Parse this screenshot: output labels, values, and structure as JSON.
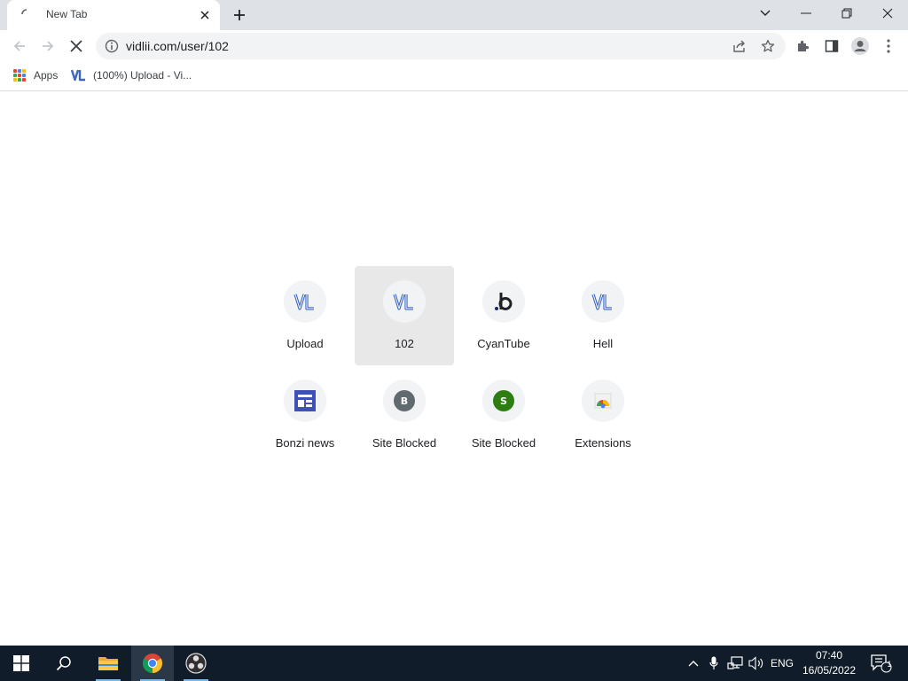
{
  "browser": {
    "tab": {
      "title": "New Tab"
    },
    "address_bar": {
      "url": "vidlii.com/user/102"
    },
    "bookmarks": [
      {
        "label": "Apps"
      },
      {
        "label": "(100%) Upload - Vi..."
      }
    ]
  },
  "shortcuts": [
    {
      "label": "Upload",
      "icon": "vidlii-logo-icon"
    },
    {
      "label": "102",
      "icon": "vidlii-logo-icon"
    },
    {
      "label": "CyanTube",
      "icon": "cyantube-b-icon"
    },
    {
      "label": "Hell",
      "icon": "vidlii-logo-icon"
    },
    {
      "label": "Bonzi news",
      "icon": "news-layout-icon"
    },
    {
      "label": "Site Blocked",
      "icon": "letter-b-icon",
      "badge_letter": "B",
      "badge_color": "#5f6b6e"
    },
    {
      "label": "Site Blocked",
      "icon": "letter-s-icon",
      "badge_letter": "S",
      "badge_color": "#2e7d12"
    },
    {
      "label": "Extensions",
      "icon": "chrome-web-store-icon"
    }
  ],
  "taskbar": {
    "time": "07:40",
    "date": "16/05/2022",
    "language": "ENG",
    "notification_count": "1"
  },
  "colors": {
    "vidlii_blue": "#3b66c4",
    "taskbar": "#101c29",
    "tab_strip": "#dee1e6"
  }
}
